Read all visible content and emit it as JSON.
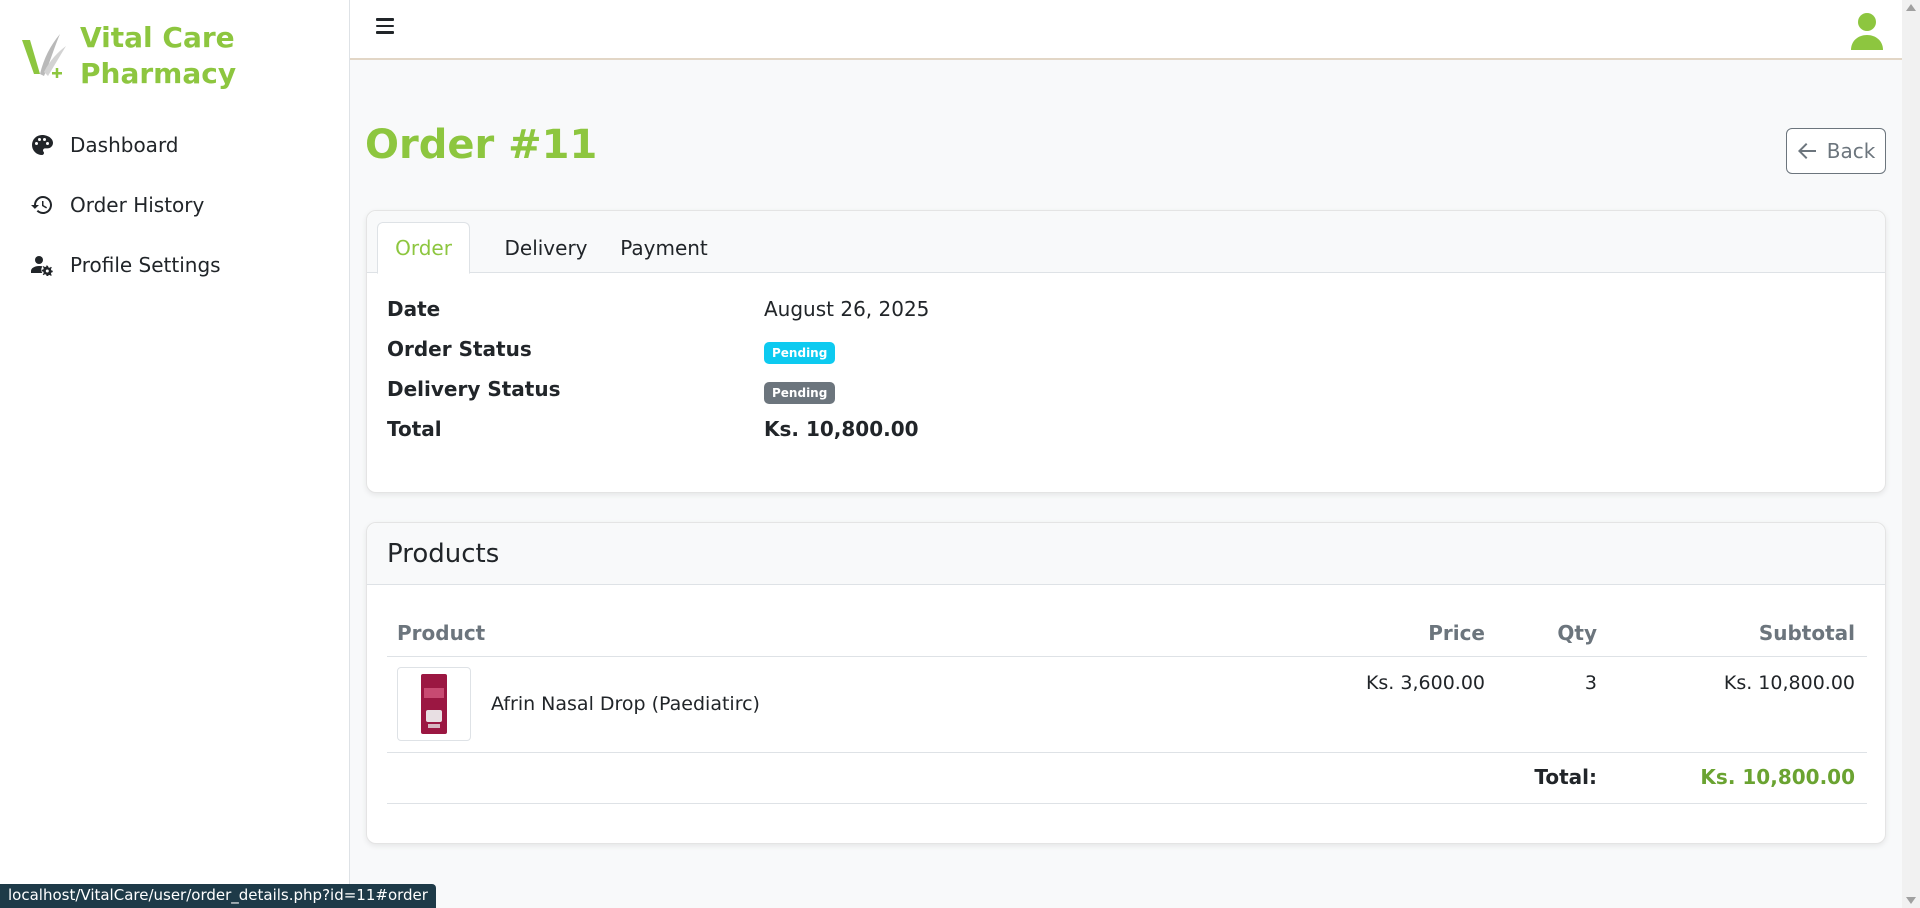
{
  "brand": {
    "line1": "Vital Care",
    "line2": "Pharmacy",
    "color": "#8dc63f"
  },
  "sidebar": {
    "items": [
      {
        "label": "Dashboard",
        "icon": "palette-icon"
      },
      {
        "label": "Order History",
        "icon": "history-icon"
      },
      {
        "label": "Profile Settings",
        "icon": "user-gear-icon"
      }
    ]
  },
  "header": {
    "menu_icon": "hamburger-icon",
    "user_icon": "user-icon"
  },
  "page": {
    "title": "Order #11",
    "back_label": "Back"
  },
  "tabs": [
    "Order",
    "Delivery",
    "Payment"
  ],
  "order": {
    "date_label": "Date",
    "date_value": "August 26, 2025",
    "status_label": "Order Status",
    "status_value": "Pending",
    "delivery_label": "Delivery Status",
    "delivery_value": "Pending",
    "total_label": "Total",
    "total_value": "Ks. 10,800.00"
  },
  "products": {
    "title": "Products",
    "columns": [
      "Product",
      "Price",
      "Qty",
      "Subtotal"
    ],
    "rows": [
      {
        "name": "Afrin Nasal Drop (Paediatirc)",
        "price": "Ks. 3,600.00",
        "qty": "3",
        "subtotal": "Ks. 10,800.00"
      }
    ],
    "total_label": "Total:",
    "total_value": "Ks. 10,800.00"
  },
  "status_url": "localhost/VitalCare/user/order_details.php?id=11#order"
}
